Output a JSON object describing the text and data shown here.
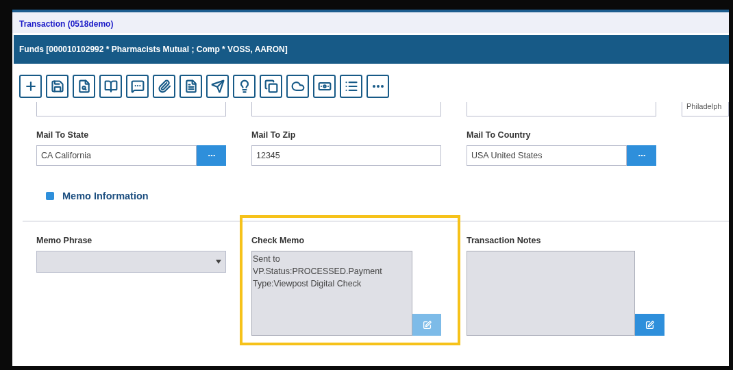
{
  "window": {
    "title": "Transaction (0518demo)"
  },
  "header": {
    "title": "Funds [000010102992 * Pharmacists Mutual ; Comp * VOSS, AARON]"
  },
  "toolbar": [
    {
      "kind": "add"
    },
    {
      "kind": "save"
    },
    {
      "kind": "preview"
    },
    {
      "kind": "book"
    },
    {
      "kind": "comment"
    },
    {
      "kind": "attach"
    },
    {
      "kind": "word"
    },
    {
      "kind": "send"
    },
    {
      "kind": "idea"
    },
    {
      "kind": "copy"
    },
    {
      "kind": "cloud"
    },
    {
      "kind": "money"
    },
    {
      "kind": "list"
    },
    {
      "kind": "more"
    }
  ],
  "address_row": {
    "last_value": "Philadelph"
  },
  "mail_fields": [
    {
      "label": "Mail To State",
      "value": "CA California",
      "lookup": true
    },
    {
      "label": "Mail To Zip",
      "value": "12345",
      "lookup": false
    },
    {
      "label": "Mail To Country",
      "value": "USA United States",
      "lookup": true
    }
  ],
  "memo_section": {
    "title": "Memo Information",
    "memo_phrase": {
      "label": "Memo Phrase"
    },
    "memos": [
      {
        "label": "Check Memo",
        "value": "Sent to\nVP.Status:PROCESSED.Payment\nType:Viewpost Digital Check",
        "highlighted": true,
        "edit_disabled": true
      },
      {
        "label": "Transaction Notes",
        "highlighted": false,
        "edit_disabled": false
      }
    ]
  }
}
